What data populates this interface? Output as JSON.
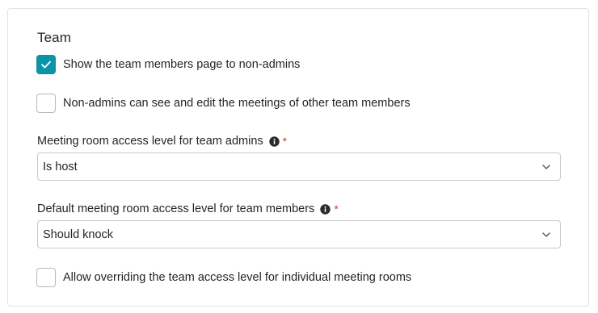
{
  "section": {
    "title": "Team"
  },
  "options": [
    {
      "label": "Show the team members page to non-admins",
      "checked": true
    },
    {
      "label": "Non-admins can see and edit the meetings of other team members",
      "checked": false
    },
    {
      "label": "Allow overriding the team access level for individual meeting rooms",
      "checked": false
    }
  ],
  "fields": [
    {
      "label": "Meeting room access level for team admins",
      "required_mark": "*",
      "value": "Is host"
    },
    {
      "label": "Default meeting room access level for team members",
      "required_mark": "*",
      "value": "Should knock"
    }
  ],
  "colors": {
    "accent": "#0d93a6",
    "required": "#e0341e",
    "border": "#c9c9c9"
  },
  "icons": {
    "info": "info-icon",
    "chevron": "chevron-down-icon",
    "check": "checkmark-icon"
  }
}
